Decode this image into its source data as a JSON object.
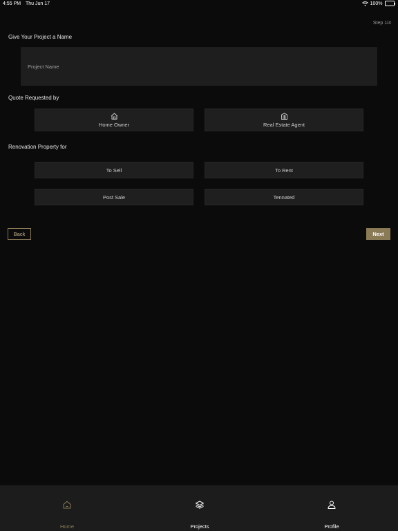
{
  "status_bar": {
    "time": "4:55 PM",
    "date": "Thu Jun 17",
    "battery": "100%"
  },
  "step": "Step 1/4",
  "project_name": {
    "title": "Give Your Project a Name",
    "placeholder": "Project Name",
    "value": ""
  },
  "quote": {
    "title": "Quote Requested by",
    "options": [
      {
        "label": "Home Owner",
        "icon": "home-icon"
      },
      {
        "label": "Real Estate Agent",
        "icon": "building-icon"
      }
    ]
  },
  "renovation": {
    "title": "Renovation Property for",
    "options": [
      {
        "label": "To Sell"
      },
      {
        "label": "To Rent"
      },
      {
        "label": "Post Sale"
      },
      {
        "label": "Tennated"
      }
    ]
  },
  "actions": {
    "back": "Back",
    "next": "Next"
  },
  "tabs": [
    {
      "label": "Home",
      "icon": "home-icon",
      "active": true
    },
    {
      "label": "Projects",
      "icon": "layers-icon",
      "active": false
    },
    {
      "label": "Profile",
      "icon": "user-icon",
      "active": false
    }
  ],
  "colors": {
    "background": "#0b0b0b",
    "surface": "#1f1f1f",
    "accent": "#8a7a55",
    "tab_bar": "#1c1c1c"
  }
}
